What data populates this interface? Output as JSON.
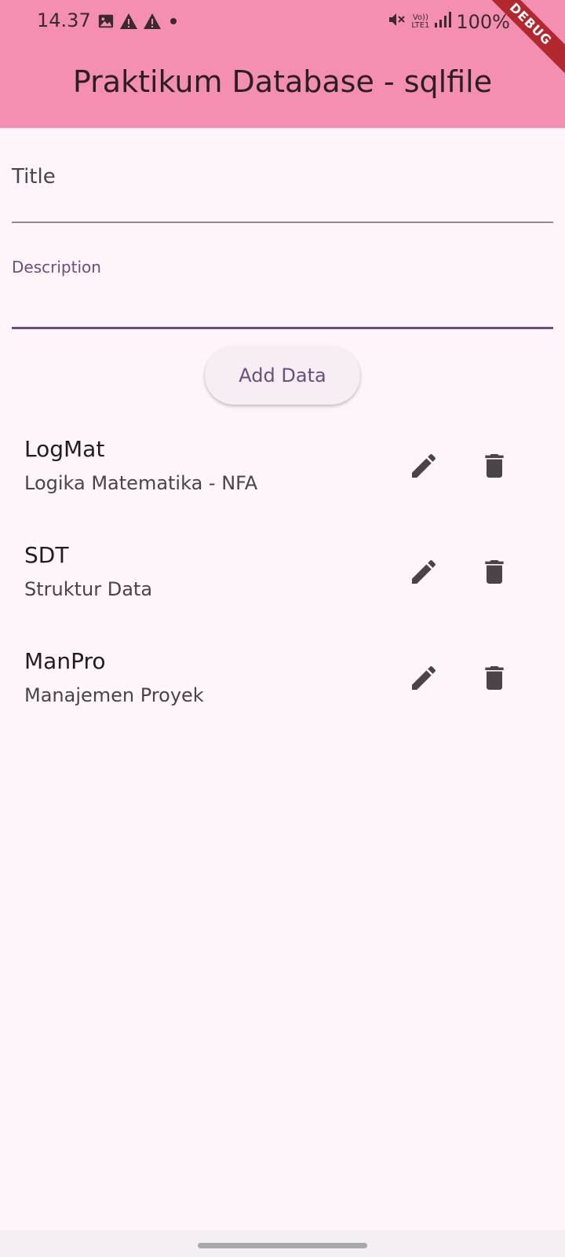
{
  "status_bar": {
    "time": "14.37",
    "battery": "100%",
    "network_lte": "LTE1",
    "network_volte": "Vo))"
  },
  "debug_banner": "DEBUG",
  "app_bar": {
    "title": "Praktikum Database - sqlfile",
    "color": "#f48fb1"
  },
  "form": {
    "title_label": "Title",
    "description_label": "Description",
    "add_button_label": "Add Data"
  },
  "items": [
    {
      "title": "LogMat",
      "subtitle": "Logika Matematika - NFA"
    },
    {
      "title": "SDT",
      "subtitle": "Struktur Data"
    },
    {
      "title": "ManPro",
      "subtitle": "Manajemen Proyek"
    }
  ],
  "colors": {
    "background": "#fef5fa",
    "accent": "#6b4e80",
    "icon": "#4a4448"
  }
}
